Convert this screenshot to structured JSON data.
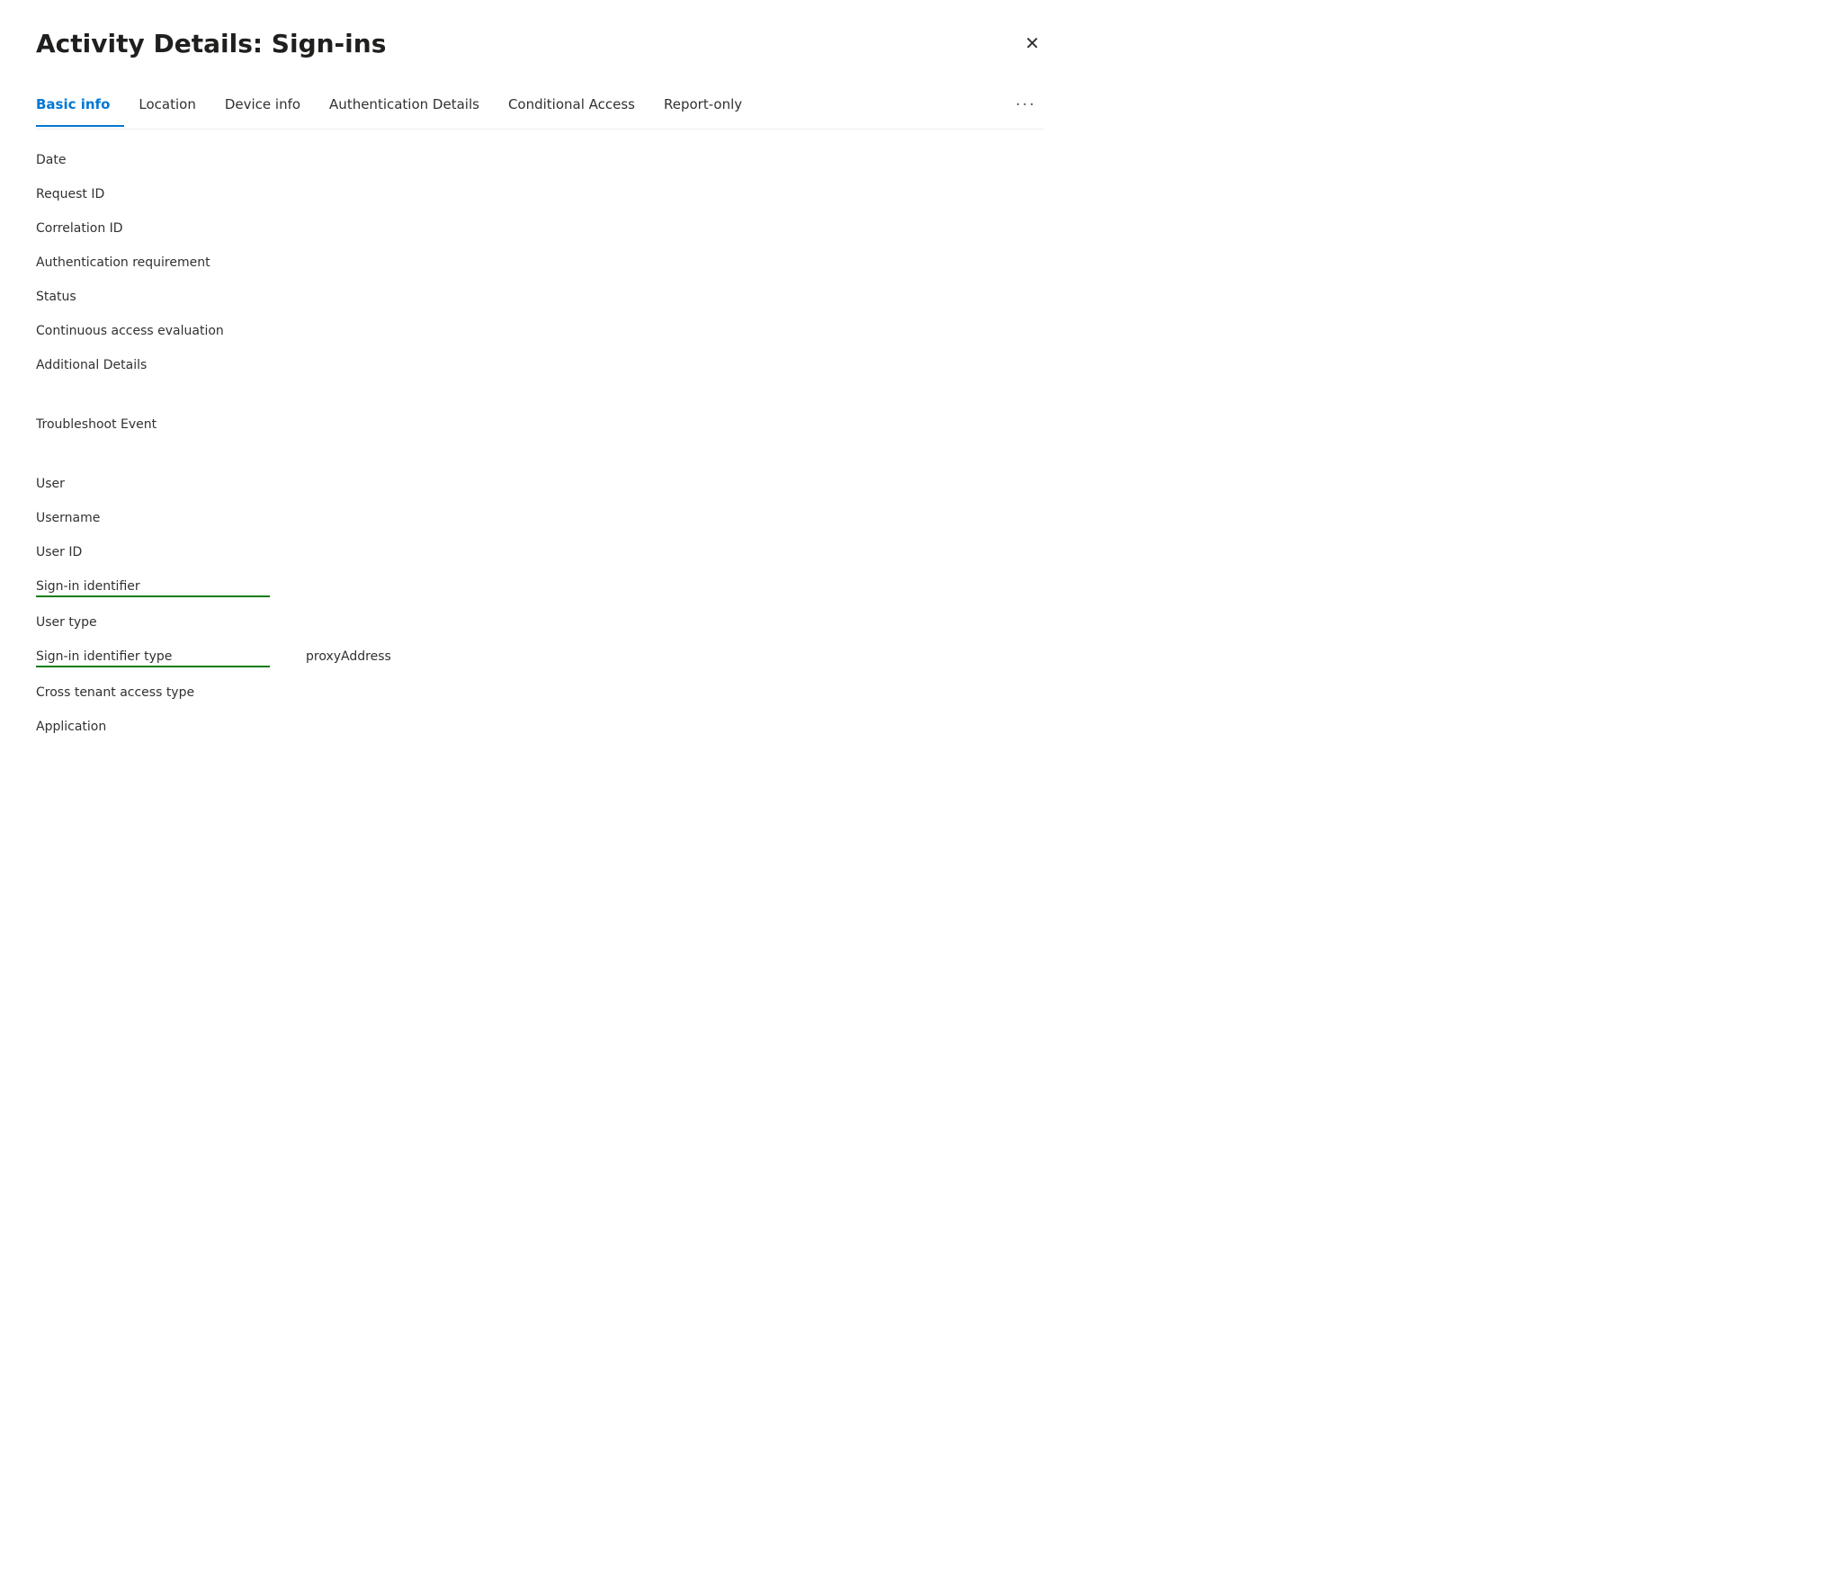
{
  "dialog": {
    "title": "Activity Details: Sign-ins",
    "close_label": "✕"
  },
  "tabs": [
    {
      "id": "basic-info",
      "label": "Basic info",
      "active": true
    },
    {
      "id": "location",
      "label": "Location",
      "active": false
    },
    {
      "id": "device-info",
      "label": "Device info",
      "active": false
    },
    {
      "id": "authentication-details",
      "label": "Authentication Details",
      "active": false
    },
    {
      "id": "conditional-access",
      "label": "Conditional Access",
      "active": false
    },
    {
      "id": "report-only",
      "label": "Report-only",
      "active": false
    }
  ],
  "tab_more_label": "···",
  "fields": [
    {
      "id": "date",
      "label": "Date",
      "value": "",
      "underlined": false
    },
    {
      "id": "request-id",
      "label": "Request ID",
      "value": "",
      "underlined": false
    },
    {
      "id": "correlation-id",
      "label": "Correlation ID",
      "value": "",
      "underlined": false
    },
    {
      "id": "auth-requirement",
      "label": "Authentication requirement",
      "value": "",
      "underlined": false
    },
    {
      "id": "status",
      "label": "Status",
      "value": "",
      "underlined": false
    },
    {
      "id": "continuous-access",
      "label": "Continuous access evaluation",
      "value": "",
      "underlined": false
    },
    {
      "id": "additional-details",
      "label": "Additional Details",
      "value": "",
      "underlined": false
    }
  ],
  "section2_fields": [
    {
      "id": "troubleshoot-event",
      "label": "Troubleshoot Event",
      "value": "",
      "underlined": false
    }
  ],
  "section3_fields": [
    {
      "id": "user",
      "label": "User",
      "value": "",
      "underlined": false
    },
    {
      "id": "username",
      "label": "Username",
      "value": "",
      "underlined": false
    },
    {
      "id": "user-id",
      "label": "User ID",
      "value": "",
      "underlined": false
    },
    {
      "id": "signin-identifier",
      "label": "Sign-in identifier",
      "value": "",
      "underlined": true
    },
    {
      "id": "user-type",
      "label": "User type",
      "value": "",
      "underlined": false
    },
    {
      "id": "signin-identifier-type",
      "label": "Sign-in identifier type",
      "value": "proxyAddress",
      "underlined": true
    },
    {
      "id": "cross-tenant-access",
      "label": "Cross tenant access type",
      "value": "",
      "underlined": false
    },
    {
      "id": "application",
      "label": "Application",
      "value": "",
      "underlined": false
    }
  ]
}
